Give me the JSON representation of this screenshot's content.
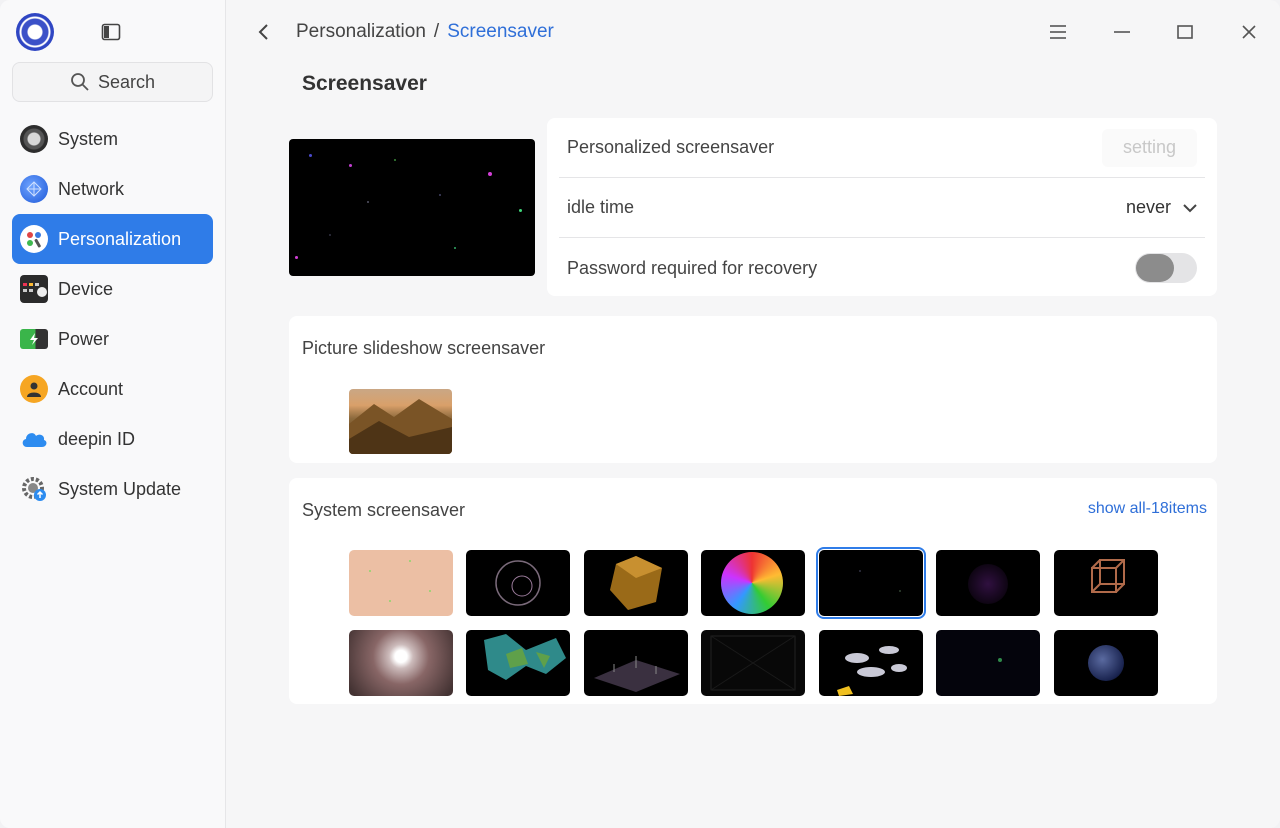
{
  "sidebar": {
    "search_label": "Search",
    "items": [
      {
        "label": "System",
        "icon": "system-icon"
      },
      {
        "label": "Network",
        "icon": "network-icon"
      },
      {
        "label": "Personalization",
        "icon": "personalization-icon"
      },
      {
        "label": "Device",
        "icon": "device-icon"
      },
      {
        "label": "Power",
        "icon": "power-icon"
      },
      {
        "label": "Account",
        "icon": "account-icon"
      },
      {
        "label": "deepin ID",
        "icon": "cloud-icon"
      },
      {
        "label": "System Update",
        "icon": "update-icon"
      }
    ],
    "active_index": 2
  },
  "breadcrumb": {
    "parent": "Personalization",
    "separator": "/",
    "current": "Screensaver"
  },
  "page_title": "Screensaver",
  "settings": {
    "personalized_label": "Personalized screensaver",
    "setting_button": "setting",
    "idle_label": "idle time",
    "idle_value": "never",
    "password_label": "Password required for recovery",
    "password_enabled": false
  },
  "slideshow": {
    "title": "Picture slideshow screensaver"
  },
  "system_screensaver": {
    "title": "System screensaver",
    "show_all": "show all-18items",
    "selected_index": 4
  },
  "colors": {
    "accent": "#2f7ce8",
    "link": "#2f6fd8"
  }
}
